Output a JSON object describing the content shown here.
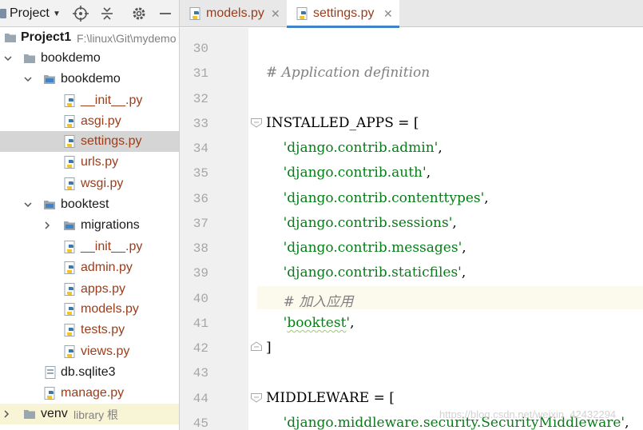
{
  "project_panel": {
    "title": "Project",
    "tree": [
      {
        "label": "Project1",
        "extra": "F:\\linux\\Git\\mydemo",
        "kind": "project"
      },
      {
        "label": "bookdemo",
        "kind": "folder"
      },
      {
        "label": "bookdemo",
        "kind": "folder"
      },
      {
        "label": "__init__.py",
        "kind": "py"
      },
      {
        "label": "asgi.py",
        "kind": "py"
      },
      {
        "label": "settings.py",
        "kind": "py",
        "selected": true
      },
      {
        "label": "urls.py",
        "kind": "py"
      },
      {
        "label": "wsgi.py",
        "kind": "py"
      },
      {
        "label": "booktest",
        "kind": "folder"
      },
      {
        "label": "migrations",
        "kind": "folder"
      },
      {
        "label": "__init__.py",
        "kind": "py"
      },
      {
        "label": "admin.py",
        "kind": "py"
      },
      {
        "label": "apps.py",
        "kind": "py"
      },
      {
        "label": "models.py",
        "kind": "py"
      },
      {
        "label": "tests.py",
        "kind": "py"
      },
      {
        "label": "views.py",
        "kind": "py"
      },
      {
        "label": "db.sqlite3",
        "kind": "file"
      },
      {
        "label": "manage.py",
        "kind": "py"
      },
      {
        "label": "venv",
        "extra": "library 根",
        "kind": "folder"
      }
    ]
  },
  "tabs": [
    {
      "label": "models.py",
      "close": "✕"
    },
    {
      "label": "settings.py",
      "close": "✕",
      "active": true
    }
  ],
  "editor": {
    "lines": [
      {
        "num": "30",
        "text": ""
      },
      {
        "num": "31",
        "text": "# Application definition"
      },
      {
        "num": "32",
        "text": ""
      },
      {
        "num": "33",
        "text": "INSTALLED_APPS = ["
      },
      {
        "num": "34",
        "pre": "    ",
        "str": "'django.contrib.admin'",
        "post": ","
      },
      {
        "num": "35",
        "pre": "    ",
        "str": "'django.contrib.auth'",
        "post": ","
      },
      {
        "num": "36",
        "pre": "    ",
        "str": "'django.contrib.contenttypes'",
        "post": ","
      },
      {
        "num": "37",
        "pre": "    ",
        "str": "'django.contrib.sessions'",
        "post": ","
      },
      {
        "num": "38",
        "pre": "    ",
        "str": "'django.contrib.messages'",
        "post": ","
      },
      {
        "num": "39",
        "pre": "    ",
        "str": "'django.contrib.staticfiles'",
        "post": ","
      },
      {
        "num": "40",
        "text": "    # 加入应用"
      },
      {
        "num": "41",
        "pre": "    ",
        "str_q1": "'",
        "str_word": "booktest",
        "str_q2": "'",
        "post": ","
      },
      {
        "num": "42",
        "text": "]"
      },
      {
        "num": "43",
        "text": ""
      },
      {
        "num": "44",
        "text": "MIDDLEWARE = ["
      },
      {
        "num": "45",
        "pre": "    ",
        "str": "'django.middleware.security.SecurityMiddleware'",
        "post": ","
      }
    ]
  },
  "watermark": "https://blog.csdn.net/weixin_42432294",
  "colors": {
    "accent": "#4083c9",
    "string": "#067d17",
    "comment": "#808080",
    "python_file": "#9b3d1a",
    "selected_row": "#d5d5d5"
  }
}
